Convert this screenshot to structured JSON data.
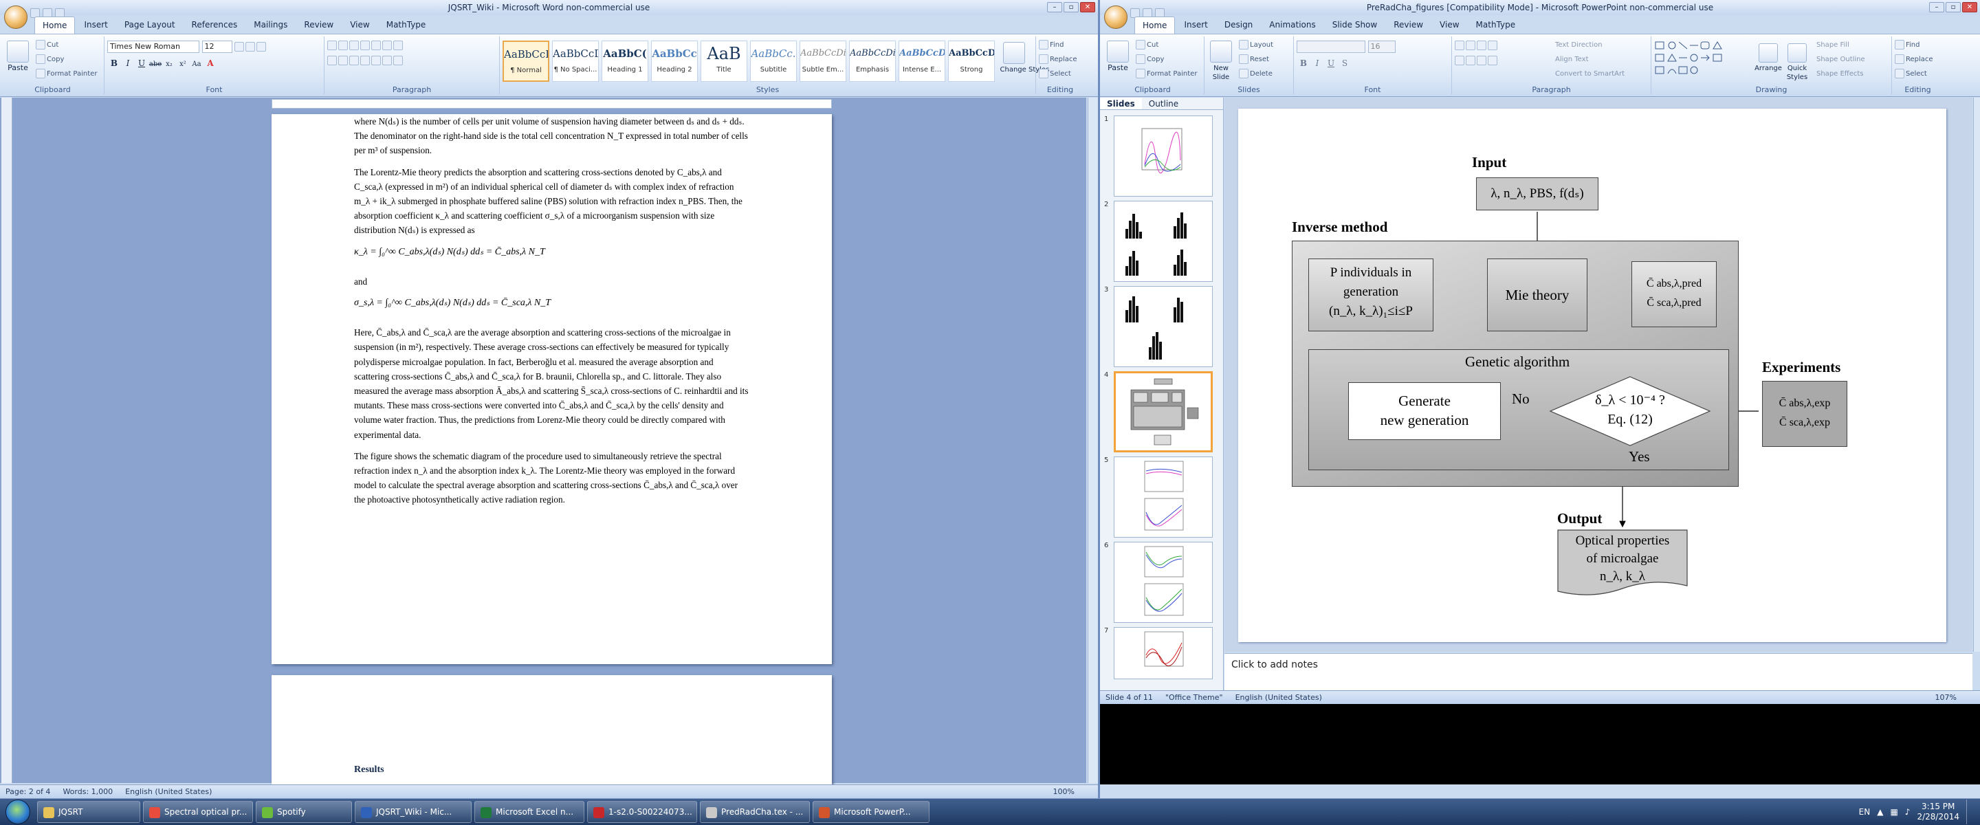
{
  "word": {
    "title": "JQSRT_Wiki - Microsoft Word non-commercial use",
    "tabs": [
      "Home",
      "Insert",
      "Page Layout",
      "References",
      "Mailings",
      "Review",
      "View",
      "MathType"
    ],
    "clipboard": {
      "paste": "Paste",
      "cut": "Cut",
      "copy": "Copy",
      "format_painter": "Format Painter",
      "label": "Clipboard"
    },
    "font": {
      "name": "Times New Roman",
      "size": "12",
      "label": "Font",
      "buttons": [
        "B",
        "I",
        "U",
        "abe",
        "x₂",
        "x²",
        "Aa"
      ]
    },
    "paragraph": {
      "label": "Paragraph"
    },
    "styles": {
      "label": "Styles",
      "items": [
        {
          "sample": "AaBbCcDc",
          "name": "¶ Normal"
        },
        {
          "sample": "AaBbCcDc",
          "name": "¶ No Spaci..."
        },
        {
          "sample": "AaBbC(",
          "name": "Heading 1"
        },
        {
          "sample": "AaBbCc",
          "name": "Heading 2"
        },
        {
          "sample": "AaB",
          "name": "Title"
        },
        {
          "sample": "AaBbCc.",
          "name": "Subtitle"
        },
        {
          "sample": "AaBbCcDi",
          "name": "Subtle Em..."
        },
        {
          "sample": "AaBbCcDi",
          "name": "Emphasis"
        },
        {
          "sample": "AaBbCcDi",
          "name": "Intense E..."
        },
        {
          "sample": "AaBbCcDc",
          "name": "Strong"
        }
      ],
      "change": "Change Styles"
    },
    "editing": {
      "find": "Find",
      "replace": "Replace",
      "select": "Select",
      "label": "Editing"
    },
    "doc": {
      "p0": "where N(dₛ) is the number of cells per unit volume of suspension having diameter between dₛ and dₛ + ddₛ. The denominator on the right-hand side is the total cell concentration N_T expressed in total number of cells per m³ of suspension.",
      "p1": "The Lorentz-Mie theory predicts the absorption and scattering cross-sections denoted by C_abs,λ and C_sca,λ (expressed in m²) of an individual spherical cell of diameter dₛ with complex index of refraction m_λ + ik_λ submerged in phosphate buffered saline (PBS) solution with refraction index n_PBS. Then, the absorption coefficient κ_λ and scattering coefficient σ_s,λ of a microorganism suspension with size distribution N(dₛ) is expressed as",
      "eq1": "κ_λ = ∫₀^∞ C_abs,λ(dₛ) N(dₛ) ddₛ = C̄_abs,λ N_T",
      "and": "and",
      "eq2": "σ_s,λ = ∫₀^∞ C_abs,λ(dₛ) N(dₛ) ddₛ = C̄_sca,λ N_T",
      "p2": "Here, C̄_abs,λ and C̄_sca,λ are the average absorption and scattering cross-sections of the microalgae in suspension (in m²), respectively. These average cross-sections can effectively be measured for typically polydisperse microalgae population. In fact, Berberoğlu et al. measured the average absorption and scattering cross-sections C̄_abs,λ and C̄_sca,λ for B. braunii, Chlorella sp., and C. littorale. They also measured the average mass absorption Ā_abs,λ and scattering S̄_sca,λ cross-sections of C. reinhardtii and its mutants. These mass cross-sections were converted into C̄_abs,λ and C̄_sca,λ by the cells' density and volume water fraction. Thus, the predictions from Lorenz-Mie theory could be directly compared with experimental data.",
      "p3": "The figure shows the schematic diagram of the procedure used to simultaneously retrieve the spectral refraction index n_λ and the absorption index k_λ. The Lorentz-Mie theory was employed in the forward model to calculate the spectral average absorption and scattering cross-sections C̄_abs,λ and C̄_sca,λ over the photoactive photosynthetically active radiation region.",
      "heading": "Results"
    },
    "status": {
      "page": "Page: 2 of 4",
      "words": "Words: 1,000",
      "lang": "English (United States)",
      "zoom": "100%"
    }
  },
  "ppt": {
    "title": "PreRadCha_figures [Compatibility Mode] - Microsoft PowerPoint non-commercial use",
    "tabs": [
      "Home",
      "Insert",
      "Design",
      "Animations",
      "Slide Show",
      "Review",
      "View",
      "MathType"
    ],
    "clipboard": {
      "paste": "Paste",
      "cut": "Cut",
      "copy": "Copy",
      "format_painter": "Format Painter",
      "label": "Clipboard"
    },
    "slides_grp": {
      "new_slide": "New Slide",
      "layout": "Layout",
      "reset": "Reset",
      "delete": "Delete",
      "label": "Slides"
    },
    "font_grp": {
      "size": "16",
      "label": "Font"
    },
    "paragraph": {
      "text_direction": "Text Direction",
      "align_text": "Align Text",
      "smartart": "Convert to SmartArt",
      "label": "Paragraph"
    },
    "drawing": {
      "arrange": "Arrange",
      "quick_styles": "Quick Styles",
      "shape_fill": "Shape Fill",
      "shape_outline": "Shape Outline",
      "shape_effects": "Shape Effects",
      "label": "Drawing"
    },
    "editing": {
      "find": "Find",
      "replace": "Replace",
      "select": "Select",
      "label": "Editing"
    },
    "panel_tabs": [
      "Slides",
      "Outline"
    ],
    "thumbs": [
      "1",
      "2",
      "3",
      "4",
      "5",
      "6",
      "7"
    ],
    "notes": "Click to add notes",
    "status": {
      "slide": "Slide 4 of 11",
      "theme": "\"Office Theme\"",
      "lang": "English (United States)",
      "zoom": "107%"
    },
    "flow": {
      "input": "Input",
      "input_box": "λ, n_λ, PBS, f(dₛ)",
      "inverse": "Inverse method",
      "p_ind_1": "P individuals in",
      "p_ind_2": "generation",
      "p_ind_3": "(n_λ, k_λ)₁≤i≤P",
      "mie": "Mie theory",
      "cpred_abs": "C̄ abs,λ,pred",
      "cpred_sca": "C̄ sca,λ,pred",
      "ga": "Genetic algorithm",
      "gen_1": "Generate",
      "gen_2": "new generation",
      "no": "No",
      "yes": "Yes",
      "cond_1": "δ_λ < 10⁻⁴ ?",
      "cond_2": "Eq. (12)",
      "experiments": "Experiments",
      "cexp_abs": "C̄ abs,λ,exp",
      "cexp_sca": "C̄ sca,λ,exp",
      "output": "Output",
      "out_1": "Optical properties",
      "out_2": "of microalgae",
      "out_3": "n_λ, k_λ"
    }
  },
  "taskbar": {
    "items": [
      {
        "label": "JQSRT",
        "color": "#e8c35a"
      },
      {
        "label": "Spectral optical pr...",
        "color": "#e84c3d"
      },
      {
        "label": "Spotify",
        "color": "#6dbb3c"
      },
      {
        "label": "JQSRT_Wiki - Mic...",
        "color": "#2f62b8"
      },
      {
        "label": "Microsoft Excel n...",
        "color": "#1f7a3c"
      },
      {
        "label": "1-s2.0-S00224073...",
        "color": "#c8282a"
      },
      {
        "label": "PredRadCha.tex - ...",
        "color": "#c9c9c9"
      },
      {
        "label": "Microsoft PowerP...",
        "color": "#d2552b"
      }
    ],
    "lang": "EN",
    "time": "3:15 PM",
    "date": "2/28/2014"
  }
}
